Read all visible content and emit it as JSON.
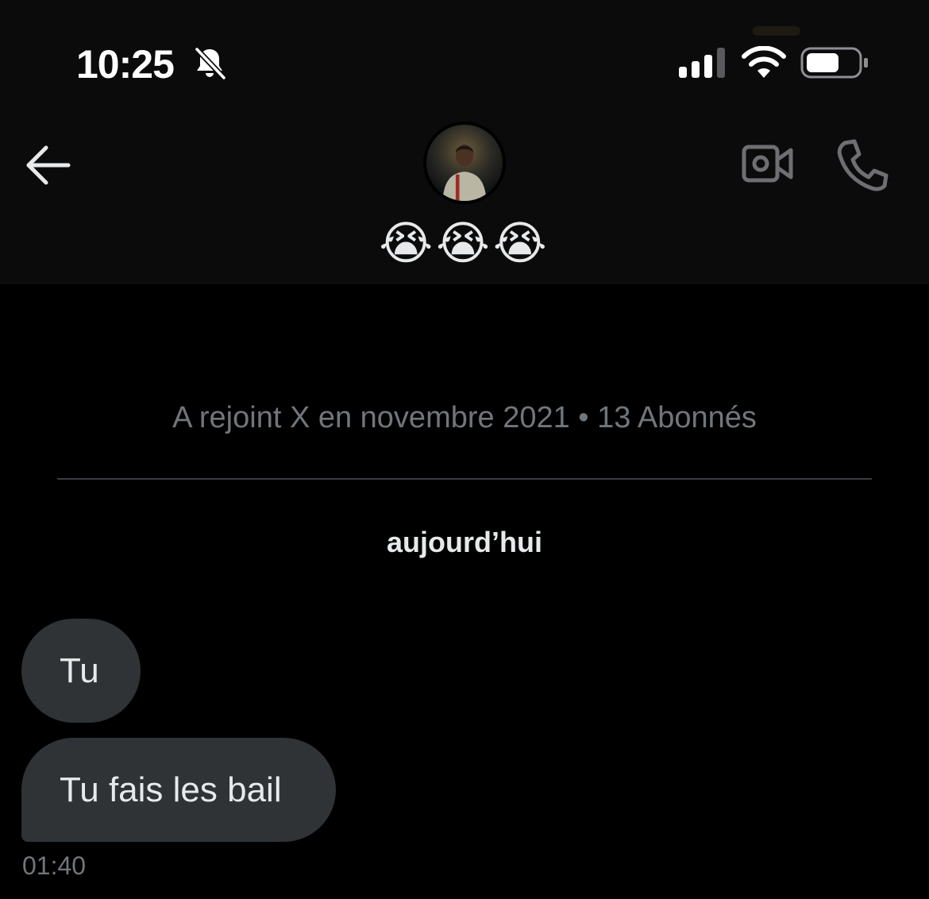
{
  "status_bar": {
    "time": "10:25",
    "icons": [
      "bell-slash-icon",
      "cellular-signal-icon",
      "wifi-icon",
      "battery-icon"
    ]
  },
  "header": {
    "back_icon": "arrow-left-icon",
    "avatar": "profile-avatar",
    "title": "😭😭😭",
    "actions": [
      "video-camera-icon",
      "phone-icon"
    ]
  },
  "conversation": {
    "join_info": "A rejoint X en novembre 2021 • 13 Abonnés",
    "date_separator": "aujourd’hui",
    "messages": [
      {
        "text": "Tu"
      },
      {
        "text": "Tu fais les bail"
      }
    ],
    "last_timestamp": "01:40"
  },
  "colors": {
    "background": "#000000",
    "header_bg": "#0b0b0c",
    "bubble_bg": "#2f3336",
    "primary_text": "#e7e9ea",
    "secondary_text": "#71767b",
    "icon_gray": "#6e6e73"
  }
}
